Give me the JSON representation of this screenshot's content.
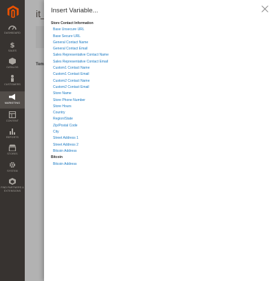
{
  "sidebar": {
    "items": [
      {
        "label": "DASHBOARD",
        "icon": "dashboard-icon"
      },
      {
        "label": "SALES",
        "icon": "dollar-icon"
      },
      {
        "label": "CATALOG",
        "icon": "cube-icon"
      },
      {
        "label": "CUSTOMERS",
        "icon": "person-icon"
      },
      {
        "label": "MARKETING",
        "icon": "megaphone-icon"
      },
      {
        "label": "CONTENT",
        "icon": "layout-icon"
      },
      {
        "label": "REPORTS",
        "icon": "bar-chart-icon"
      },
      {
        "label": "STORES",
        "icon": "store-icon"
      },
      {
        "label": "SYSTEM",
        "icon": "gear-icon"
      },
      {
        "label": "FIND PARTNERS & EXTENSIONS",
        "icon": "extensions-icon"
      }
    ],
    "active_index": 4
  },
  "background_page": {
    "title": "it_",
    "field_label": "Tem"
  },
  "modal": {
    "title": "Insert Variable...",
    "close_icon": "close-icon",
    "groups": [
      {
        "title": "Store Contact Information",
        "variables": [
          "Base Unsecure URL",
          "Base Secure URL",
          "General Contact Name",
          "General Contact Email",
          "Sales Representative Contact Name",
          "Sales Representative Contact Email",
          "Custom1 Contact Name",
          "Custom1 Contact Email",
          "Custom2 Contact Name",
          "Custom2 Contact Email",
          "Store Name",
          "Store Phone Number",
          "Store Hours",
          "Country",
          "Region/State",
          "Zip/Postal Code",
          "City",
          "Street Address 1",
          "Street Address 2",
          "Bitcoin Address"
        ]
      },
      {
        "title": "Bitcoin",
        "variables": [
          "Bitcoin Address"
        ]
      }
    ]
  },
  "colors": {
    "sidebar_bg": "#373330",
    "sidebar_active": "#524d49",
    "link": "#1979c3",
    "logo": "#eb5202"
  }
}
